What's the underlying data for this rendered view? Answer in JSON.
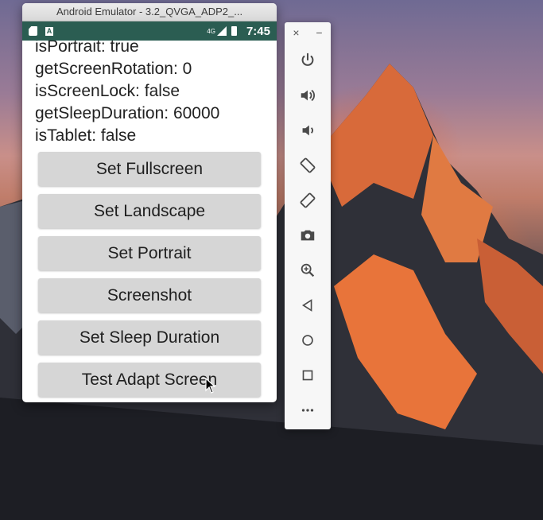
{
  "window": {
    "title": "Android Emulator - 3.2_QVGA_ADP2_..."
  },
  "status_bar": {
    "time": "7:45",
    "network": "4G"
  },
  "info_lines": [
    "isPortrait: true",
    "getScreenRotation: 0",
    "isScreenLock: false",
    "getSleepDuration: 60000",
    "isTablet: false"
  ],
  "buttons": [
    "Set Fullscreen",
    "Set Landscape",
    "Set Portrait",
    "Screenshot",
    "Set Sleep Duration",
    "Test Adapt Screen"
  ],
  "toolbar": {
    "close": "×",
    "minimize": "−",
    "items": [
      "power-icon",
      "volume-up-icon",
      "volume-down-icon",
      "rotate-left-icon",
      "rotate-right-icon",
      "camera-icon",
      "zoom-icon",
      "back-icon",
      "home-icon",
      "overview-icon",
      "more-icon"
    ]
  },
  "colors": {
    "status_bar": "#2b5d52",
    "button": "#d6d6d6"
  }
}
